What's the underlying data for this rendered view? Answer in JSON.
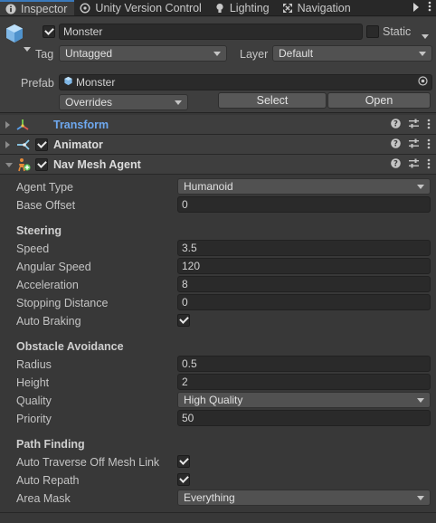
{
  "tabs": [
    {
      "label": "Inspector",
      "icon": "info-icon",
      "active": true
    },
    {
      "label": "Unity Version Control",
      "icon": "version-control-icon",
      "active": false
    },
    {
      "label": "Lighting",
      "icon": "lightbulb-icon",
      "active": false
    },
    {
      "label": "Navigation",
      "icon": "navigation-icon",
      "active": false
    }
  ],
  "object": {
    "name": "Monster",
    "active": true,
    "static_label": "Static",
    "tag_label": "Tag",
    "tag_value": "Untagged",
    "layer_label": "Layer",
    "layer_value": "Default",
    "prefab_label": "Prefab",
    "prefab_value": "Monster",
    "overrides_value": "Overrides",
    "select_button": "Select",
    "open_button": "Open"
  },
  "components": [
    {
      "title": "Transform",
      "expanded": false,
      "has_checkbox": false,
      "icon": "transform-icon"
    },
    {
      "title": "Animator",
      "expanded": false,
      "has_checkbox": true,
      "icon": "animator-icon"
    },
    {
      "title": "Nav Mesh Agent",
      "expanded": true,
      "has_checkbox": true,
      "icon": "nav-mesh-agent-icon"
    }
  ],
  "navmesh": {
    "agent_type_label": "Agent Type",
    "agent_type_value": "Humanoid",
    "base_offset_label": "Base Offset",
    "base_offset_value": "0",
    "steering_header": "Steering",
    "speed_label": "Speed",
    "speed_value": "3.5",
    "angular_speed_label": "Angular Speed",
    "angular_speed_value": "120",
    "acceleration_label": "Acceleration",
    "acceleration_value": "8",
    "stopping_distance_label": "Stopping Distance",
    "stopping_distance_value": "0",
    "auto_braking_label": "Auto Braking",
    "auto_braking_checked": true,
    "obstacle_header": "Obstacle Avoidance",
    "radius_label": "Radius",
    "radius_value": "0.5",
    "height_label": "Height",
    "height_value": "2",
    "quality_label": "Quality",
    "quality_value": "High Quality",
    "priority_label": "Priority",
    "priority_value": "50",
    "pathfinding_header": "Path Finding",
    "auto_traverse_label": "Auto Traverse Off Mesh Link",
    "auto_traverse_checked": true,
    "auto_repath_label": "Auto Repath",
    "auto_repath_checked": true,
    "area_mask_label": "Area Mask",
    "area_mask_value": "Everything"
  },
  "colors": {
    "accent": "#3a79bb",
    "transform_title": "#6ea8ef",
    "panel_bg": "#383838",
    "header_bg": "#3e3e3e",
    "field_bg": "#2a2a2a"
  }
}
